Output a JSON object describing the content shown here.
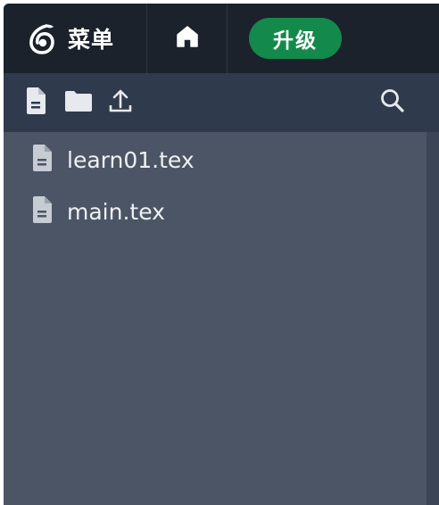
{
  "topbar": {
    "menu_label": "菜单",
    "upgrade_label": "升级",
    "upgrade_color": "#138a4b",
    "logo_icon": "overleaf-leaf-icon",
    "home_icon": "home-icon"
  },
  "file_toolbar": {
    "tools": [
      "new-file-icon",
      "new-folder-icon",
      "upload-icon"
    ],
    "search_icon": "search-icon"
  },
  "files": [
    {
      "name": "learn01.tex",
      "icon": "file-icon"
    },
    {
      "name": "main.tex",
      "icon": "file-icon"
    }
  ]
}
